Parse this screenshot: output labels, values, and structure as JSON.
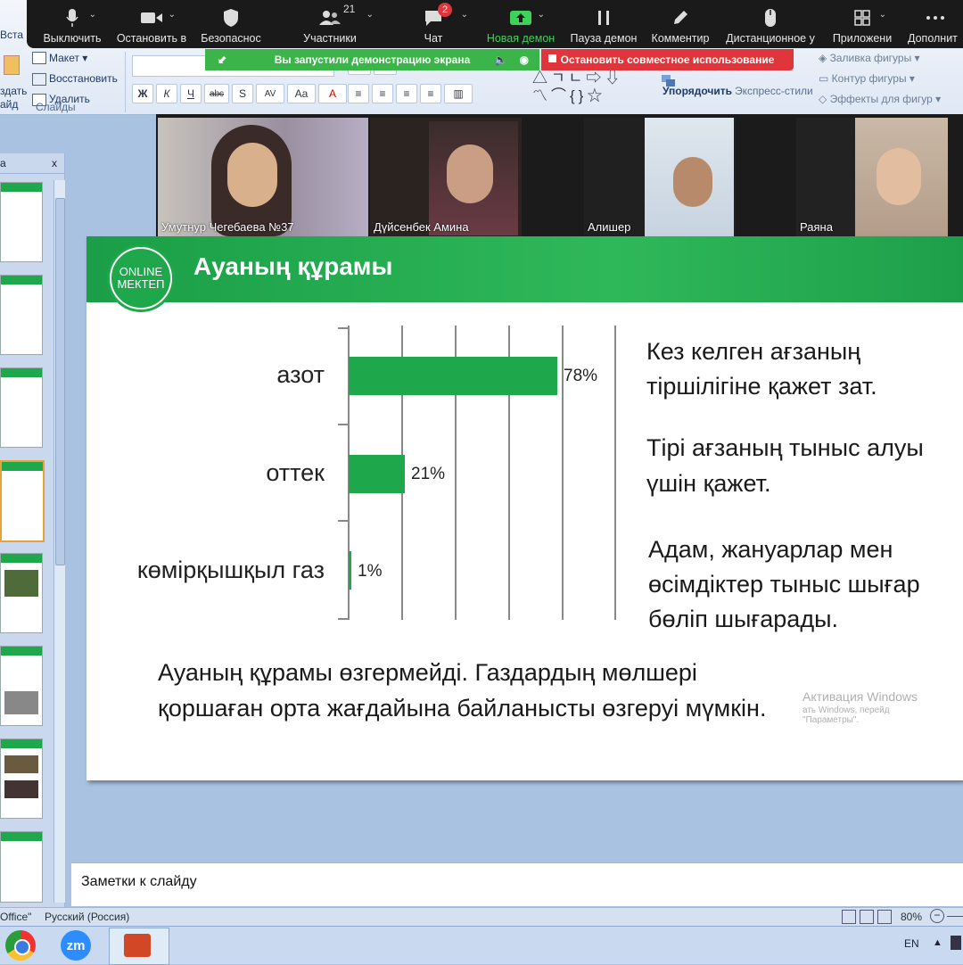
{
  "zoom_toolbar": {
    "buttons": [
      {
        "label": "Выключить",
        "icon": "microphone-icon"
      },
      {
        "label": "Остановить в",
        "icon": "video-camera-icon"
      },
      {
        "label": "Безопаснос",
        "icon": "shield-icon"
      },
      {
        "label": "Участники",
        "icon": "participants-icon",
        "count": "21"
      },
      {
        "label": "Чат",
        "icon": "chat-icon",
        "badge": "2"
      },
      {
        "label": "Новая демон",
        "icon": "share-screen-icon"
      },
      {
        "label": "Пауза демон",
        "icon": "pause-icon"
      },
      {
        "label": "Комментир",
        "icon": "pencil-icon"
      },
      {
        "label": "Дистанционное у",
        "icon": "mouse-icon"
      },
      {
        "label": "Приложени",
        "icon": "apps-icon"
      },
      {
        "label": "Дополнит",
        "icon": "more-icon"
      }
    ],
    "share_banner": "Вы запустили демонстрацию экрана",
    "stop_share": "Остановить совместное использование"
  },
  "ribbon": {
    "left": {
      "insert": "Вста",
      "layout": "Макет",
      "restore": "Восстановить",
      "delete": "Удалить",
      "create": "здать",
      "slide": "айд",
      "group": "Слайды"
    },
    "font_buttons": [
      "Ж",
      "К",
      "Ч",
      "abc",
      "S",
      "AV",
      "Aa",
      "A"
    ],
    "arrange": "Упорядочить",
    "quick_styles": "Экспресс-стили",
    "shape_fill": "Заливка фигуры",
    "shape_outline": "Контур фигуры",
    "shape_effects": "Эффекты для фигур"
  },
  "video_tiles": [
    {
      "name": "Умутнур Чегебаева №37"
    },
    {
      "name": "Дүйсенбек Амина"
    },
    {
      "name": "Алишер"
    },
    {
      "name": "Раяна"
    }
  ],
  "slides_panel": {
    "tab": "а",
    "close": "x"
  },
  "slide": {
    "title": "Ауаның құрамы",
    "logo_line1": "ONLINE",
    "logo_line2": "МЕКТЕП",
    "right_text": [
      "Кез келген ағзаның",
      "тіршілігіне қажет зат.",
      "Тірі ағзаның тыныс алуы",
      "үшін қажет.",
      "Адам, жануарлар мен",
      "өсімдіктер тыныс шығар",
      "бөліп шығарады."
    ],
    "bottom_text": [
      "Ауаның құрамы өзгермейді. Газдардың мөлшері",
      "қоршаған орта жағдайына байланысты өзгеруі мүмкін."
    ]
  },
  "chart_data": {
    "type": "bar",
    "orientation": "horizontal",
    "categories": [
      "азот",
      "оттек",
      "көмірқышқыл газ"
    ],
    "values": [
      78,
      21,
      1
    ],
    "value_labels": [
      "78%",
      "21%",
      "1%"
    ],
    "xlim": [
      0,
      100
    ],
    "grid": true,
    "color": "#1fa84b"
  },
  "activation": {
    "line1": "Активация Windows",
    "line2": "ать Windows, перейд",
    "line3": "\"Параметры\"."
  },
  "notes": {
    "placeholder": "Заметки к слайду"
  },
  "statusbar": {
    "theme": "Office\"",
    "language": "Русский (Россия)",
    "zoom": "80%"
  },
  "taskbar": {
    "lang": "EN",
    "apps": [
      "chrome-icon",
      "zoom-icon",
      "powerpoint-icon"
    ],
    "zoom_app_label": "zm"
  }
}
